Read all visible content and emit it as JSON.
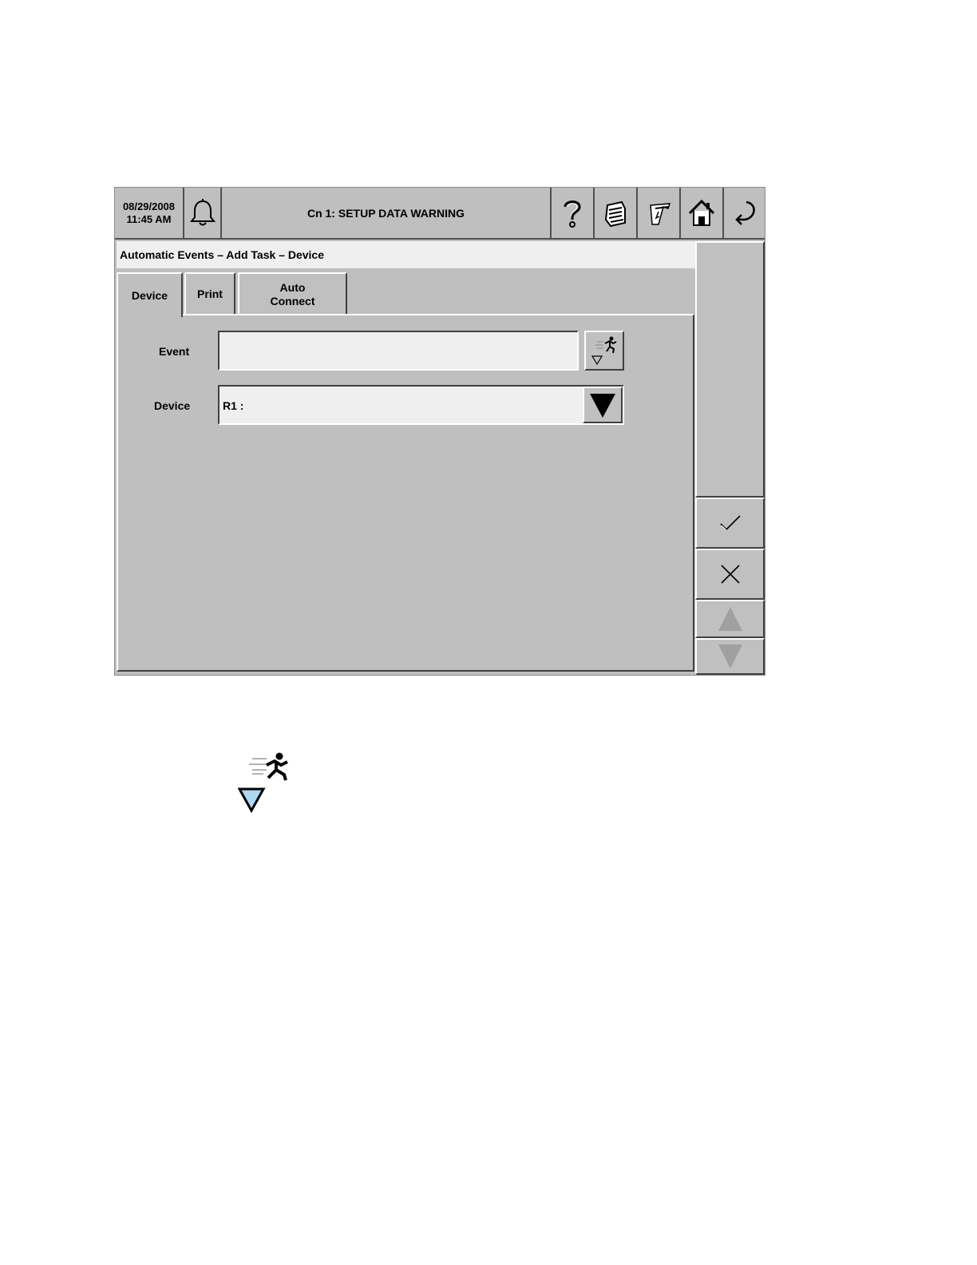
{
  "topbar": {
    "date": "08/29/2008",
    "time": "11:45 AM",
    "status": "Cn 1: SETUP DATA WARNING",
    "buttons": [
      "alarm-icon",
      "help-icon",
      "print-icon",
      "paper-feed-icon",
      "home-icon",
      "back-icon"
    ]
  },
  "breadcrumb": "Automatic Events – Add Task – Device",
  "tabs": [
    {
      "label": "Device",
      "active": true
    },
    {
      "label": "Print",
      "active": false
    },
    {
      "label": "Auto\nConnect",
      "label_line1": "Auto",
      "label_line2": "Connect",
      "active": false
    }
  ],
  "form": {
    "event_label": "Event",
    "event_value": "",
    "device_label": "Device",
    "device_value": "R1 :"
  },
  "side": {
    "buttons": [
      "checkmark-icon",
      "close-icon",
      "scroll-up-icon",
      "scroll-down-icon"
    ]
  },
  "colors": {
    "background": "#bfbfbf",
    "field": "#efefef",
    "legend_triangle": "#aed8f0"
  },
  "legend": {
    "icon": "run-event-icon"
  }
}
